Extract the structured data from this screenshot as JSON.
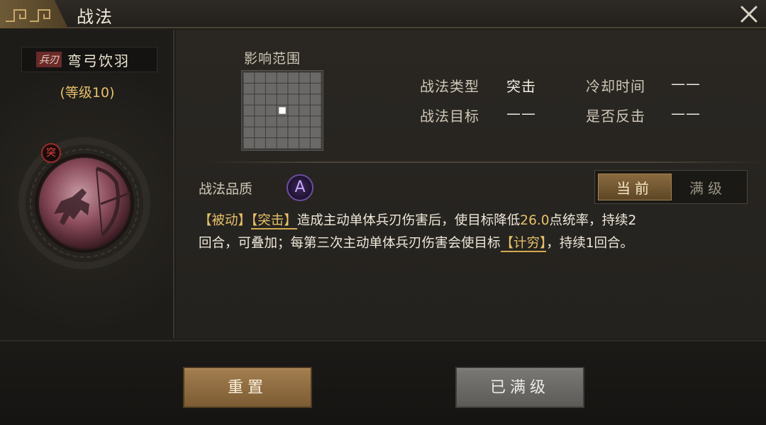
{
  "window": {
    "title": "战法",
    "close_icon": "close-icon"
  },
  "skill": {
    "type_tag": "兵刃",
    "name": "弯弓饮羽",
    "level": "(等级10)",
    "category_badge": "突"
  },
  "range": {
    "label": "影响范围",
    "grid_size": 7,
    "highlight_cell": [
      3,
      3
    ]
  },
  "info": {
    "type_label": "战法类型",
    "type_value": "突击",
    "cooldown_label": "冷却时间",
    "cooldown_value": "——",
    "target_label": "战法目标",
    "target_value": "——",
    "counter_label": "是否反击",
    "counter_value": "——"
  },
  "quality": {
    "label": "战法品质",
    "grade": "A"
  },
  "toggle": {
    "current": "当前",
    "max": "满级"
  },
  "description": {
    "line1": {
      "t1": "【被动】",
      "t2": "【突击】",
      "t3": "造成主动单体兵刃伤害后，使目标降低",
      "t4": "26.0",
      "t5": "点统率，持续2"
    },
    "line2": {
      "t1": "回合，可叠加；每第三次主动单体兵刃伤害会使目标",
      "t2": "【计穷】",
      "t3": "，持续1回合。"
    }
  },
  "buttons": {
    "reset": "重置",
    "maxed": "已满级"
  },
  "colors": {
    "accent_gold": "#e6c06a",
    "quality_purple": "#6c4da0"
  }
}
